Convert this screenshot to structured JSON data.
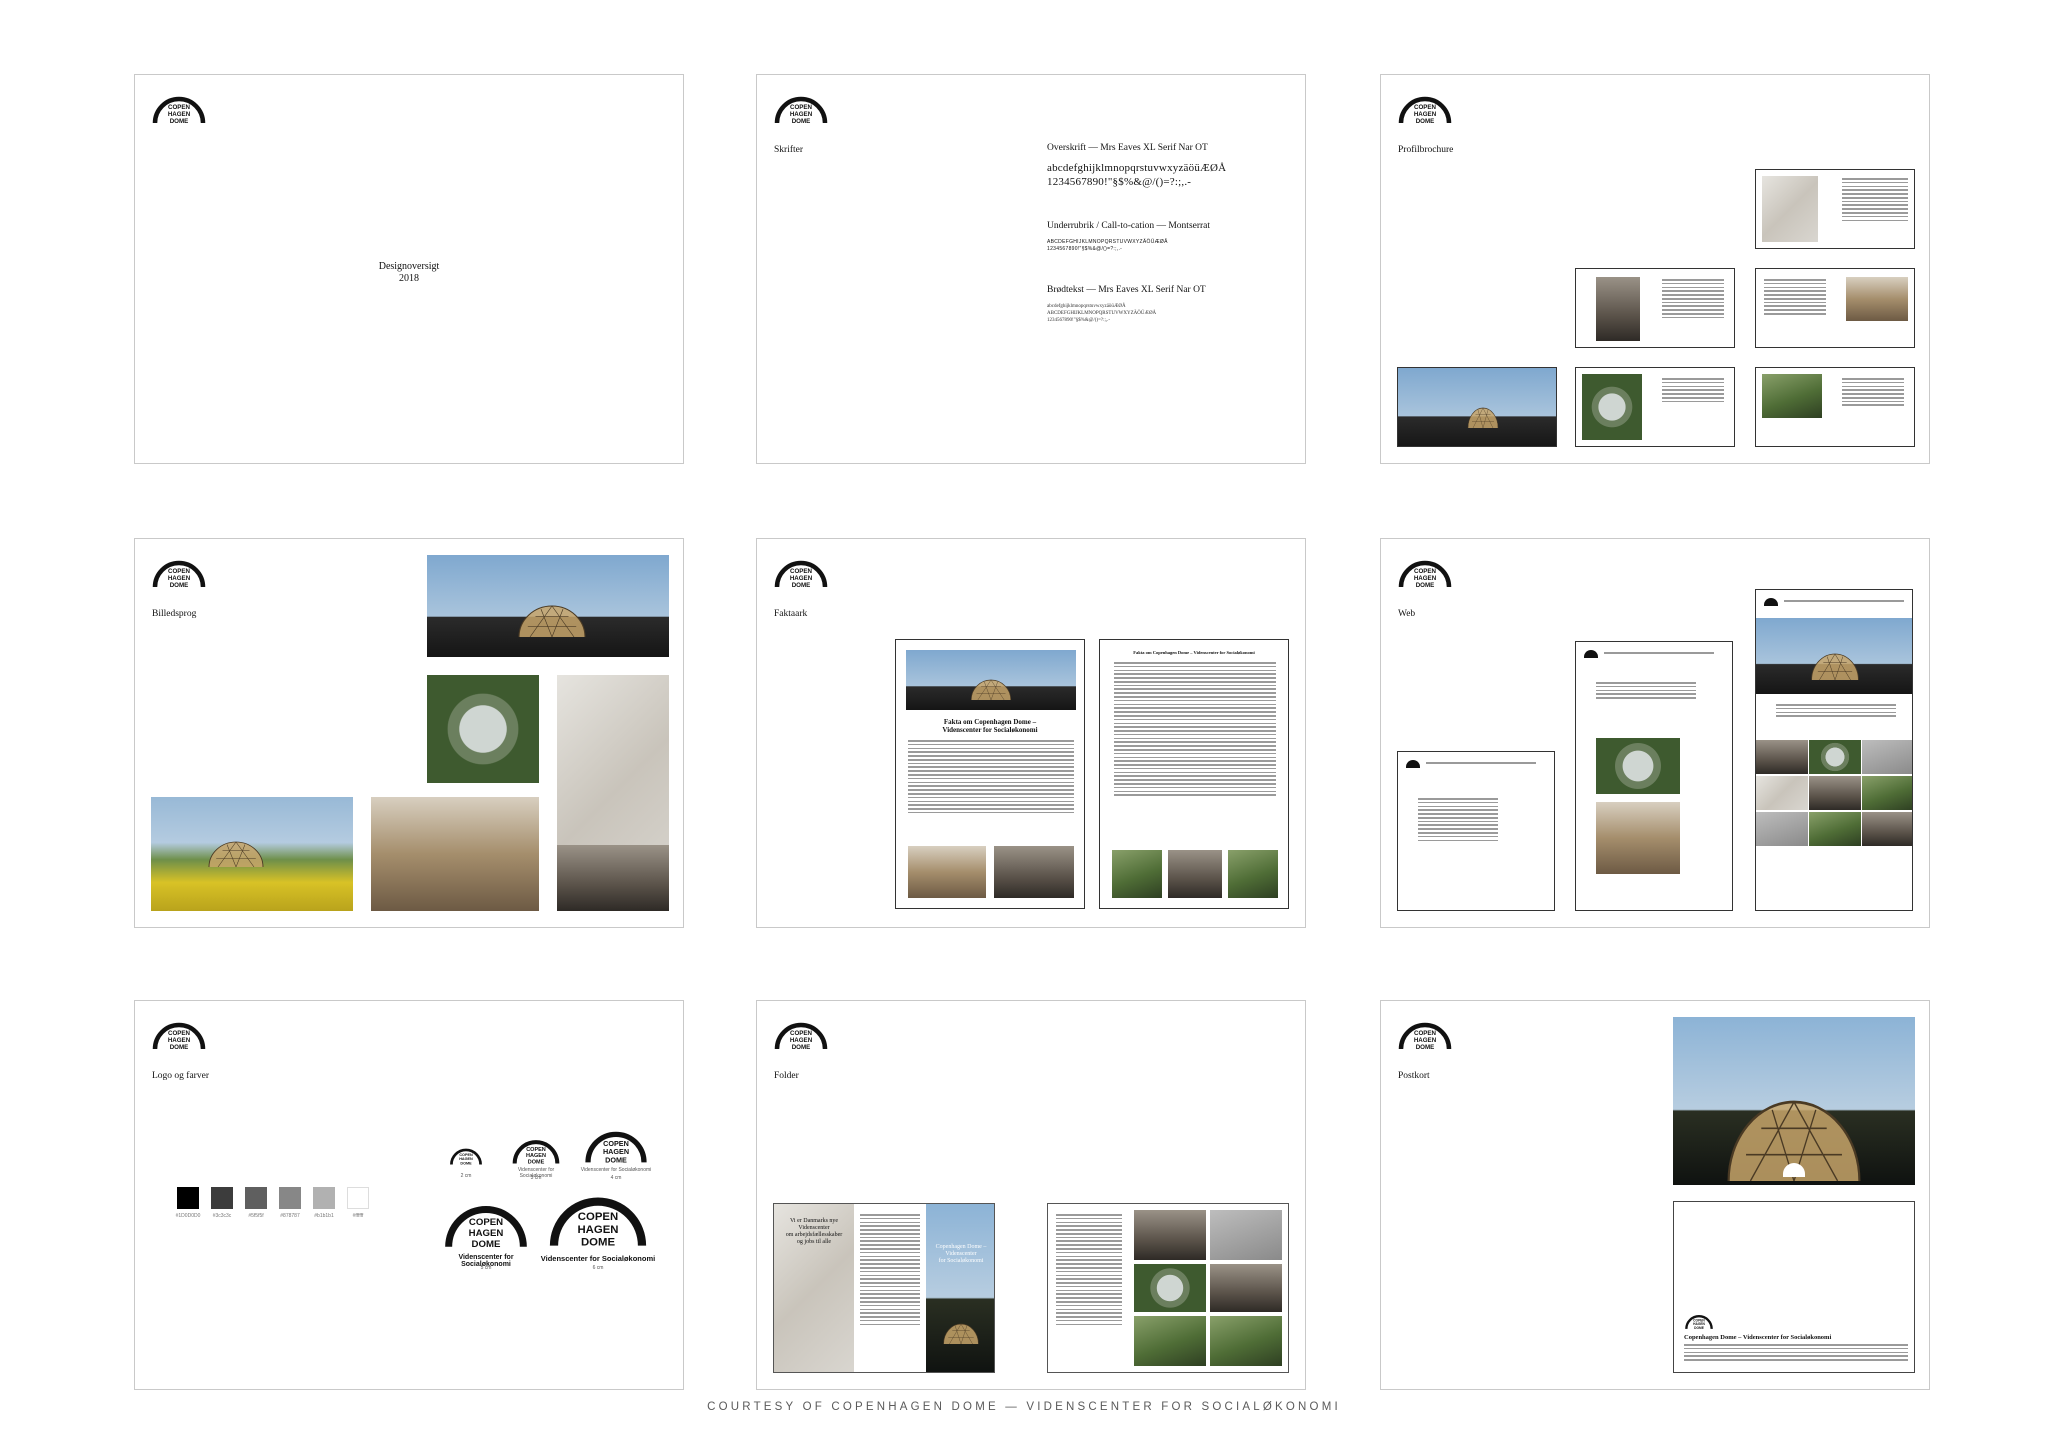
{
  "brand": {
    "logo_text": [
      "COPEN",
      "HAGEN",
      "DOME"
    ],
    "tagline": "Videnscenter for Socialøkonomi"
  },
  "panels": {
    "cover": {
      "title": "Designoversigt",
      "year": "2018"
    },
    "fonts": {
      "title": "Skrifter",
      "heading_label": "Overskrift — Mrs Eaves XL Serif Nar OT",
      "heading_glyphs_1": "abcdefghijklmnopqrstuvwxyzäöüÆØÅ",
      "heading_glyphs_2": "1234567890!\"§$%&@/()=?:;,.-",
      "subheading_label": "Underrubrik / Call-to-cation — Montserrat",
      "subheading_glyphs_1": "ABCDEFGHIJKLMNOPQRSTUVWXYZÄÖÜÆØÅ",
      "subheading_glyphs_2": "1234567890!\"§$%&@/()=?:;,.-",
      "body_label": "Brødtekst — Mrs Eaves XL Serif Nar OT",
      "body_glyphs_1": "abcdefghijklmnopqrstuvwxyzäöüÆØÅ",
      "body_glyphs_2": "ABCDEFGHIJKLMNOPQRSTUVWXYZÄÖÜÆØÅ",
      "body_glyphs_3": "1234567890!\"§$%&@/()=?:;,.-"
    },
    "brochure": {
      "title": "Profilbrochure"
    },
    "imagery": {
      "title": "Billedsprog"
    },
    "factsheet": {
      "title": "Faktaark",
      "page_heading_1": "Fakta om Copenhagen Dome –",
      "page_heading_2": "Videnscenter for Socialøkonomi",
      "page2_heading": "Fakta om Copenhagen Dome – Videnscenter for Socialøkonomi"
    },
    "web": {
      "title": "Web"
    },
    "logo_colors": {
      "title": "Logo og farver",
      "swatches": [
        {
          "hex": "#000000",
          "label": "#1D0D0D0"
        },
        {
          "hex": "#3c3c3c",
          "label": "#3c3c3c"
        },
        {
          "hex": "#5f5f5f",
          "label": "#5f5f5f"
        },
        {
          "hex": "#878787",
          "label": "#878787"
        },
        {
          "hex": "#b1b1b1",
          "label": "#b1b1b1"
        },
        {
          "hex": "#ffffff",
          "label": "#ffffff"
        }
      ],
      "sizes": [
        "2 cm",
        "3 cm",
        "4 cm",
        "5 cm",
        "6 cm"
      ]
    },
    "folder": {
      "title": "Folder",
      "cover_text_1": "Vi er Danmarks nye",
      "cover_text_2": "Videnscenter",
      "cover_text_3": "om arbejdsfællesskaber",
      "cover_text_4": "og jobs til alle",
      "back_text_1": "Copenhagen Dome –",
      "back_text_2": "Videnscenter",
      "back_text_3": "for Socialøkonomi"
    },
    "postcard": {
      "title": "Postkort",
      "back_heading": "Copenhagen Dome – Videnscenter for Socialøkonomi"
    }
  },
  "footer": "COURTESY OF COPENHAGEN DOME — VIDENSCENTER FOR SOCIALØKONOMI"
}
